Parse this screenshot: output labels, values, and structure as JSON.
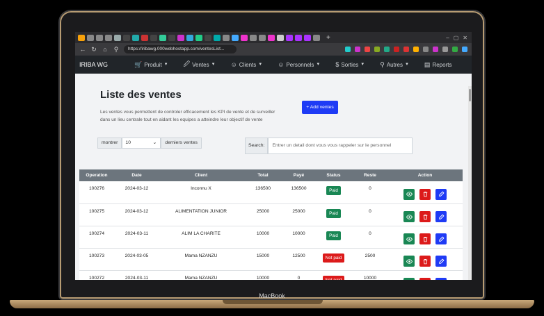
{
  "device": {
    "label": "MacBook"
  },
  "browser": {
    "url": "https://iribawg.000webhostapp.com/ventesList...",
    "tab_colors": [
      "#f7a10a",
      "#888",
      "#888",
      "#888",
      "#9aa",
      "#444",
      "#2aa",
      "#c33",
      "#444",
      "#3c9",
      "#444",
      "#c3c",
      "#3ad",
      "#2c8",
      "#444",
      "#0aa",
      "#888",
      "#4af",
      "#e3c",
      "#888",
      "#888",
      "#e3c",
      "#ccc",
      "#a3f",
      "#a3f",
      "#a3f",
      "#888"
    ],
    "ext_colors": [
      "#2cc",
      "#c3c",
      "#e44",
      "#8a2",
      "#2a8",
      "#c22",
      "#d33",
      "#ffb000",
      "#888",
      "#c3c",
      "#999",
      "#3a4",
      "#4af"
    ]
  },
  "navbar": {
    "brand": "IRIBA WG",
    "items": [
      {
        "label": "Produit",
        "icon": "cart-icon",
        "glyph": "🛒",
        "caret": true
      },
      {
        "label": "Ventes",
        "icon": "ventes-icon",
        "glyph": "🖉",
        "caret": true
      },
      {
        "label": "Clients",
        "icon": "clients-icon",
        "glyph": "☺",
        "caret": true
      },
      {
        "label": "Personnels",
        "icon": "personnels-icon",
        "glyph": "☺",
        "caret": true
      },
      {
        "label": "Sorties",
        "icon": "dollar-icon",
        "glyph": "$",
        "caret": true
      },
      {
        "label": "Autres",
        "icon": "autres-icon",
        "glyph": "⚲",
        "caret": true
      },
      {
        "label": "Reports",
        "icon": "reports-icon",
        "glyph": "▤",
        "caret": false
      }
    ]
  },
  "page": {
    "title": "Liste des ventes",
    "lead": "Les ventes vous permettent de controler efficacement les KPI de vente et de surveiller dans un lieu centrale tout en aidant les equipes a atteindre leur objectif de vente",
    "add_button": "+ Add ventes"
  },
  "filters": {
    "show_label": "montrer",
    "show_value": "10",
    "show_suffix": "derniers ventes",
    "search_label": "Search:",
    "search_placeholder": "Entrer un detail dont vous vous rappeler sur le personnel"
  },
  "table": {
    "headers": [
      "Operation",
      "Date",
      "Client",
      "Total",
      "Payé",
      "Status",
      "Reste",
      "Action"
    ],
    "rows": [
      {
        "operation": "100276",
        "date": "2024-03-12",
        "client": "Inconnu X",
        "total": "136500",
        "paye": "136500",
        "status": "Paid",
        "reste": "0"
      },
      {
        "operation": "100275",
        "date": "2024-03-12",
        "client": "ALIMENTATION JUNIOR",
        "total": "25000",
        "paye": "25000",
        "status": "Paid",
        "reste": "0"
      },
      {
        "operation": "100274",
        "date": "2024-03-11",
        "client": "ALIM LA CHARITE",
        "total": "10000",
        "paye": "10000",
        "status": "Paid",
        "reste": "0"
      },
      {
        "operation": "100273",
        "date": "2024-03-05",
        "client": "Mama NZANZU",
        "total": "15000",
        "paye": "12500",
        "status": "Not paid",
        "reste": "2500"
      },
      {
        "operation": "100272",
        "date": "2024-03-11",
        "client": "Mama NZANZU",
        "total": "10000",
        "paye": "0",
        "status": "Not paid",
        "reste": "10000"
      }
    ],
    "colors": {
      "paid": "#198754",
      "not_paid": "#dc1a1a",
      "edit": "#1f3bf5"
    }
  }
}
